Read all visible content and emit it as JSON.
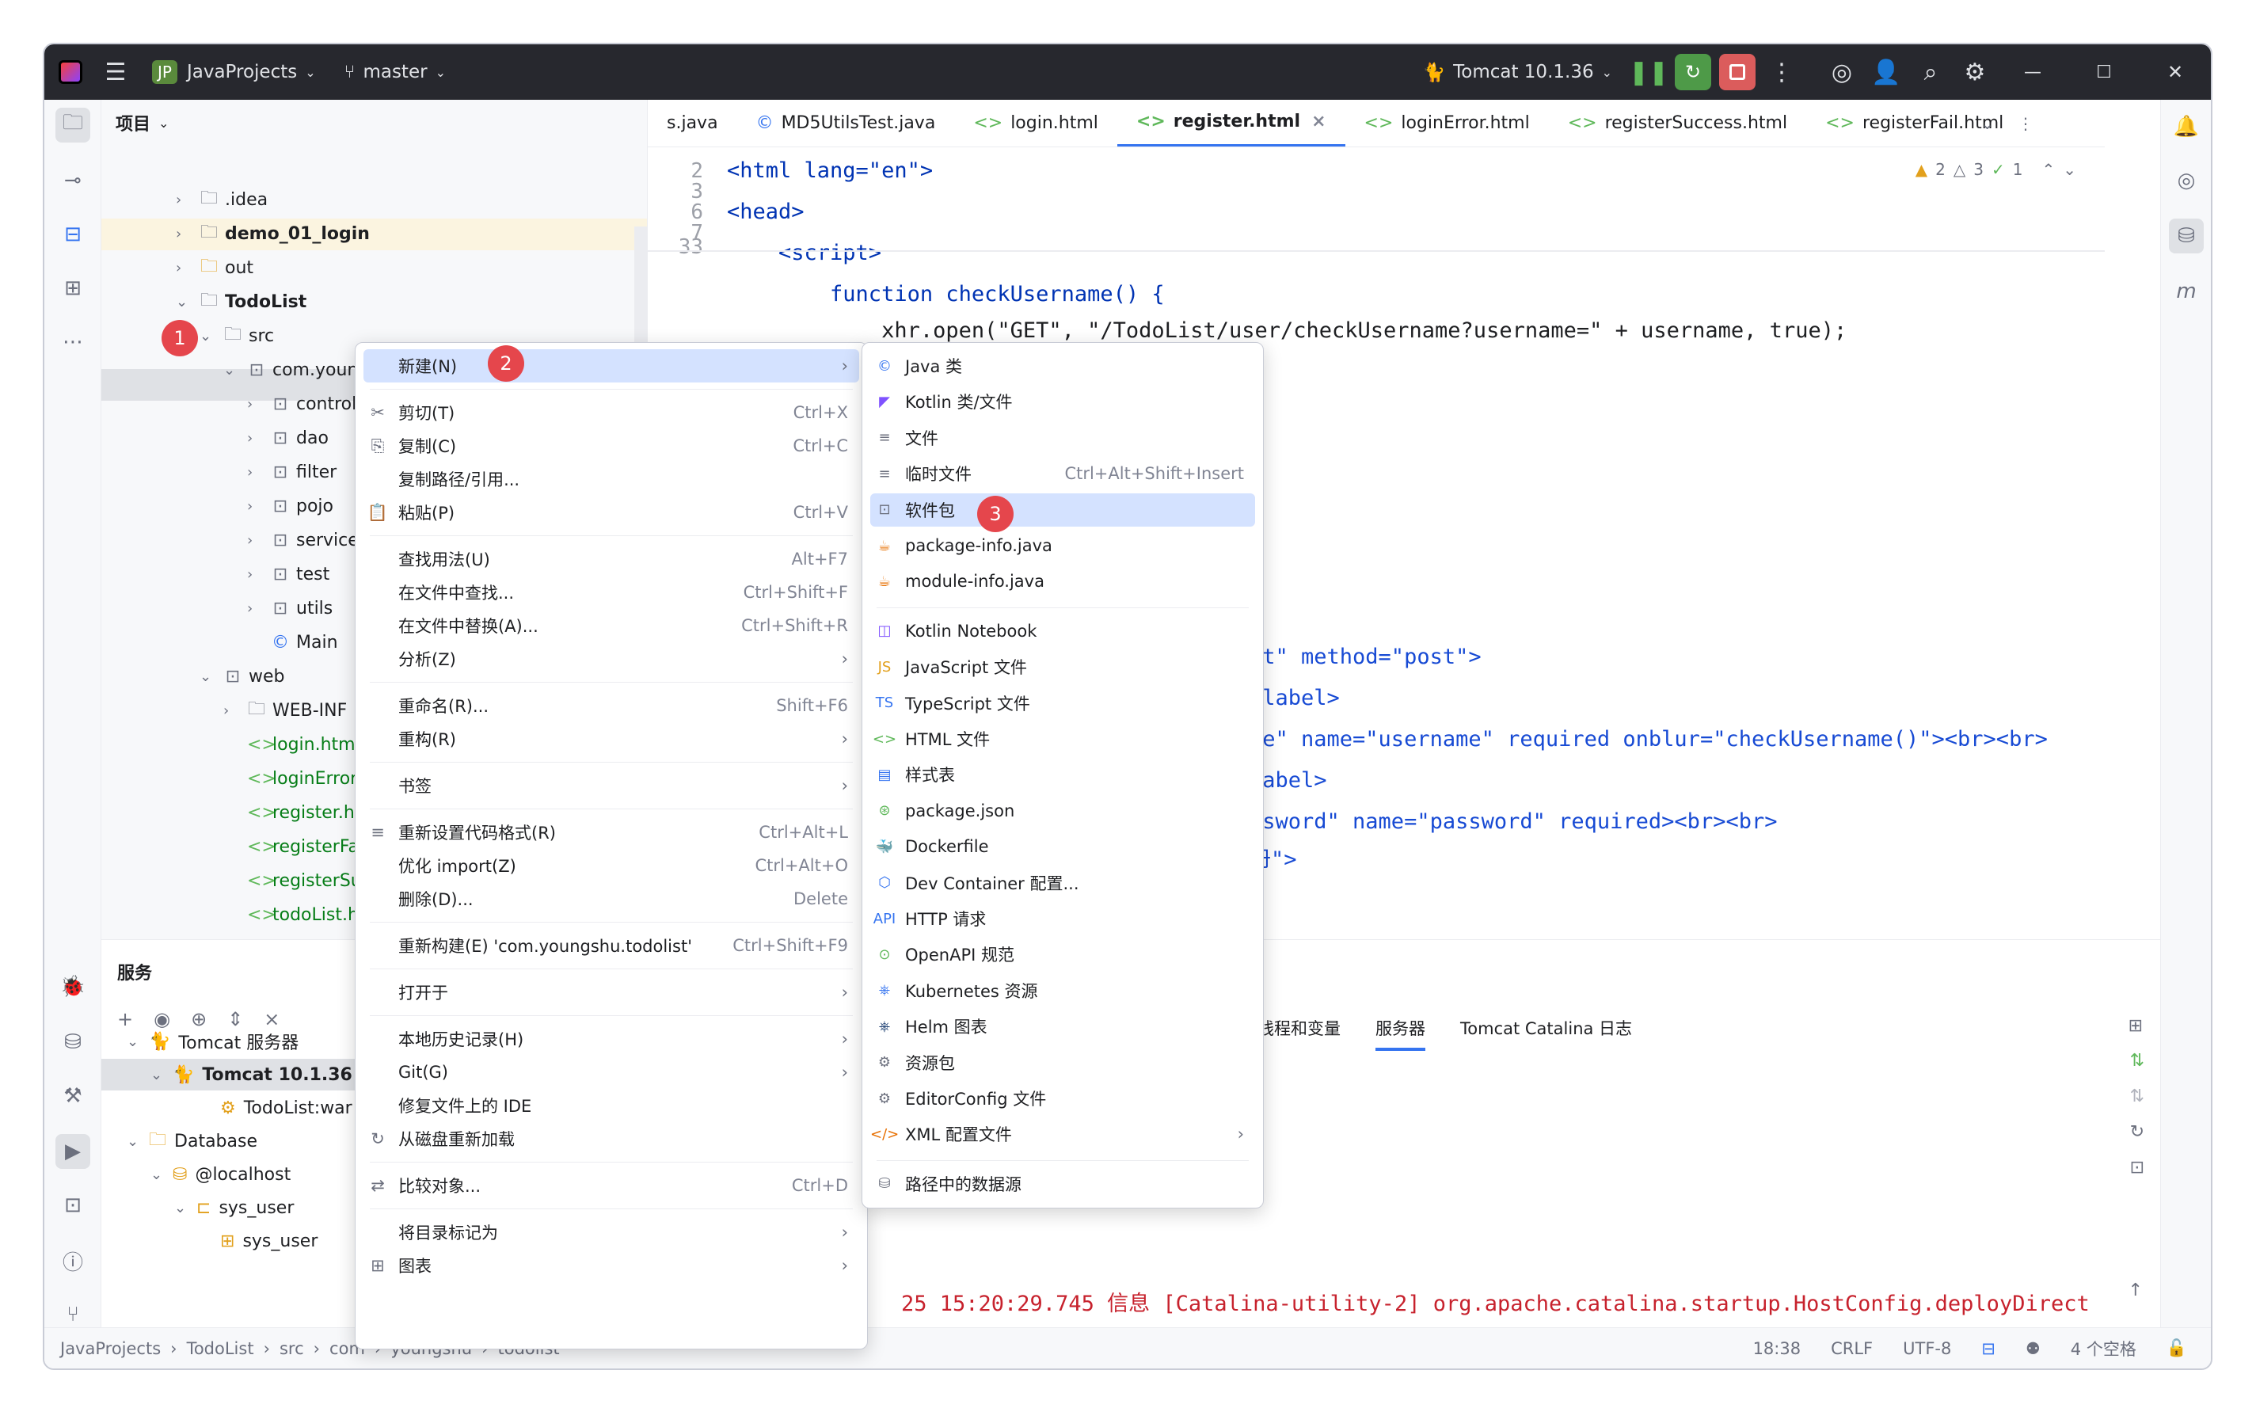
{
  "titlebar": {
    "project_badge": "JP",
    "project_name": "JavaProjects",
    "branch": "master",
    "run_config": "Tomcat 10.1.36"
  },
  "project_panel": {
    "title": "项目",
    "tree": [
      ".idea",
      "demo_01_login",
      "out",
      "TodoList",
      "src",
      "com.youngshu.todolist",
      "controller",
      "dao",
      "filter",
      "pojo",
      "service",
      "test",
      "utils",
      "Main",
      "web",
      "WEB-INF",
      "login.html",
      "loginError.html",
      "register.html",
      "registerFail.html",
      "registerSuccess.html",
      "todoList.html"
    ]
  },
  "editor": {
    "tabs": [
      "s.java",
      "MD5UtilsTest.java",
      "login.html",
      "register.html",
      "loginError.html",
      "registerSuccess.html",
      "registerFail.html"
    ],
    "active_tab": "register.html",
    "inspections": {
      "warnings": "2",
      "weak": "3",
      "ok": "1"
    },
    "line_numbers": [
      "2",
      "3",
      "6",
      "7",
      "33"
    ],
    "code_lines": [
      "<html lang=\"en\">",
      "<head>",
      "    <script>",
      "        function checkUsername() {",
      "            xhr.open(\"GET\", \"/TodoList/user/checkUsername?username=\" + username, true);"
    ],
    "partial_lines": [
      "st\" method=\"post\">",
      "/label>",
      "ne\" name=\"username\" required onblur=\"checkUsername()\"><br><br>",
      "label>",
      "ssword\" name=\"password\" required><br><br>",
      "册\">"
    ]
  },
  "services": {
    "title": "服务",
    "tree": [
      "Tomcat 服务器",
      "Tomcat 10.1.36",
      "TodoList:war",
      "Database",
      "@localhost",
      "sys_user",
      "sys_user"
    ],
    "tabs": [
      "线程和变量",
      "服务器",
      "Tomcat Catalina 日志"
    ],
    "log_lines": [
      "25 15:20:29.745 信息 [Catalina-utility-2] org.apache.catalina.startup.HostConfig.deployDirect"
    ]
  },
  "context_menu": {
    "items": [
      {
        "label": "新建(N)",
        "shortcut": "",
        "submenu": true
      },
      {
        "label": "剪切(T)",
        "shortcut": "Ctrl+X"
      },
      {
        "label": "复制(C)",
        "shortcut": "Ctrl+C"
      },
      {
        "label": "复制路径/引用...",
        "shortcut": ""
      },
      {
        "label": "粘贴(P)",
        "shortcut": "Ctrl+V"
      },
      {
        "label": "查找用法(U)",
        "shortcut": "Alt+F7"
      },
      {
        "label": "在文件中查找...",
        "shortcut": "Ctrl+Shift+F"
      },
      {
        "label": "在文件中替换(A)...",
        "shortcut": "Ctrl+Shift+R"
      },
      {
        "label": "分析(Z)",
        "shortcut": "",
        "submenu": true
      },
      {
        "label": "重命名(R)...",
        "shortcut": "Shift+F6"
      },
      {
        "label": "重构(R)",
        "shortcut": "",
        "submenu": true
      },
      {
        "label": "书签",
        "shortcut": "",
        "submenu": true
      },
      {
        "label": "重新设置代码格式(R)",
        "shortcut": "Ctrl+Alt+L"
      },
      {
        "label": "优化 import(Z)",
        "shortcut": "Ctrl+Alt+O"
      },
      {
        "label": "删除(D)...",
        "shortcut": "Delete"
      },
      {
        "label": "重新构建(E) 'com.youngshu.todolist'",
        "shortcut": "Ctrl+Shift+F9"
      },
      {
        "label": "打开于",
        "shortcut": "",
        "submenu": true
      },
      {
        "label": "本地历史记录(H)",
        "shortcut": "",
        "submenu": true
      },
      {
        "label": "Git(G)",
        "shortcut": "",
        "submenu": true
      },
      {
        "label": "修复文件上的 IDE",
        "shortcut": ""
      },
      {
        "label": "从磁盘重新加载",
        "shortcut": ""
      },
      {
        "label": "比较对象...",
        "shortcut": "Ctrl+D"
      },
      {
        "label": "将目录标记为",
        "shortcut": "",
        "submenu": true
      },
      {
        "label": "图表",
        "shortcut": "",
        "submenu": true
      }
    ]
  },
  "new_submenu": {
    "items": [
      {
        "label": "Java 类",
        "shortcut": ""
      },
      {
        "label": "Kotlin 类/文件",
        "shortcut": ""
      },
      {
        "label": "文件",
        "shortcut": ""
      },
      {
        "label": "临时文件",
        "shortcut": "Ctrl+Alt+Shift+Insert"
      },
      {
        "label": "软件包",
        "shortcut": ""
      },
      {
        "label": "package-info.java",
        "shortcut": ""
      },
      {
        "label": "module-info.java",
        "shortcut": ""
      },
      {
        "label": "Kotlin Notebook",
        "shortcut": ""
      },
      {
        "label": "JavaScript 文件",
        "shortcut": ""
      },
      {
        "label": "TypeScript 文件",
        "shortcut": ""
      },
      {
        "label": "HTML 文件",
        "shortcut": ""
      },
      {
        "label": "样式表",
        "shortcut": ""
      },
      {
        "label": "package.json",
        "shortcut": ""
      },
      {
        "label": "Dockerfile",
        "shortcut": ""
      },
      {
        "label": "Dev Container 配置...",
        "shortcut": ""
      },
      {
        "label": "HTTP 请求",
        "shortcut": ""
      },
      {
        "label": "OpenAPI 规范",
        "shortcut": ""
      },
      {
        "label": "Kubernetes 资源",
        "shortcut": ""
      },
      {
        "label": "Helm 图表",
        "shortcut": ""
      },
      {
        "label": "资源包",
        "shortcut": ""
      },
      {
        "label": "EditorConfig 文件",
        "shortcut": ""
      },
      {
        "label": "XML 配置文件",
        "shortcut": ""
      },
      {
        "label": "路径中的数据源",
        "shortcut": ""
      }
    ]
  },
  "step_badges": [
    "1",
    "2",
    "3"
  ],
  "statusbar": {
    "breadcrumb": [
      "JavaProjects",
      "TodoList",
      "src",
      "com",
      "youngshu",
      "todolist"
    ],
    "position": "18:38",
    "line_sep": "CRLF",
    "encoding": "UTF-8",
    "indent": "4 个空格"
  },
  "colors": {
    "accent": "#3574f0",
    "titlebar": "#27282e",
    "badge": "#e5464c",
    "selection": "#d4e2ff"
  }
}
